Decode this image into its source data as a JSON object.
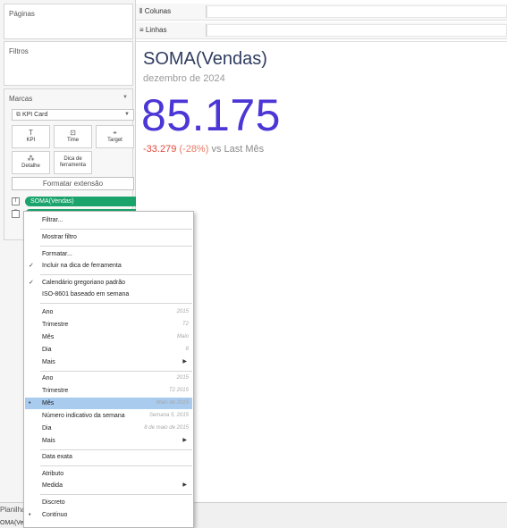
{
  "panels": {
    "pages_title": "Páginas",
    "filters_title": "Filtros",
    "marks_title": "Marcas",
    "mark_type": "KPI Card",
    "mark_buttons": [
      {
        "label": "KPI",
        "icon": "kpi-icon"
      },
      {
        "label": "Time",
        "icon": "time-icon"
      },
      {
        "label": "Target",
        "icon": "target-icon"
      },
      {
        "label": "Detalhe",
        "icon": "detail-icon"
      },
      {
        "label": "Dica de ferramenta",
        "icon": "tooltip-icon"
      }
    ],
    "format_button": "Formatar extensão",
    "pills": [
      {
        "label": "SOMA(Vendas)",
        "icon": "text-icon"
      },
      {
        "label": "",
        "icon": "chart-icon"
      }
    ]
  },
  "shelves": {
    "columns": "Colunas",
    "rows": "Linhas"
  },
  "view": {
    "title": "SOMA(Vendas)",
    "subtitle": "dezembro de 2024",
    "value": "85.175",
    "delta_value": "-33.279",
    "delta_pct": "(-28%)",
    "delta_suffix": "vs Last Mês",
    "colors": {
      "value": "#4b36d6",
      "negative": "#e0483a",
      "pill": "#1aa36b",
      "highlight": "#a8cbee"
    }
  },
  "bottom": {
    "sheet_tab": "Planilha",
    "status": "OMA(Ven"
  },
  "context_menu": {
    "items": [
      {
        "label": "Filtrar...",
        "right": "",
        "check": "",
        "submenu": false
      },
      {
        "label": "Mostrar filtro",
        "right": "",
        "check": "",
        "submenu": false
      },
      {
        "label": "Formatar...",
        "right": "",
        "check": "",
        "submenu": false
      },
      {
        "label": "Incluir na dica de ferramenta",
        "right": "",
        "check": "✓",
        "submenu": false
      },
      {
        "label": "Calendário gregoriano padrão",
        "right": "",
        "check": "✓",
        "submenu": false
      },
      {
        "label": "ISO-8601 baseado em semana",
        "right": "",
        "check": "",
        "submenu": false
      },
      {
        "label": "Ano",
        "right": "2015",
        "check": "",
        "submenu": false
      },
      {
        "label": "Trimestre",
        "right": "T2",
        "check": "",
        "submenu": false
      },
      {
        "label": "Mês",
        "right": "Maio",
        "check": "",
        "submenu": false
      },
      {
        "label": "Dia",
        "right": "8",
        "check": "",
        "submenu": false
      },
      {
        "label": "Mais",
        "right": "",
        "check": "",
        "submenu": true
      },
      {
        "label": "Ano",
        "right": "2015",
        "check": "",
        "submenu": false
      },
      {
        "label": "Trimestre",
        "right": "T2 2015",
        "check": "",
        "submenu": false
      },
      {
        "label": "Mês",
        "right": "Maio de 2015",
        "check": "•",
        "submenu": false,
        "highlighted": true
      },
      {
        "label": "Número indicativo da semana",
        "right": "Semana 5, 2015",
        "check": "",
        "submenu": false
      },
      {
        "label": "Dia",
        "right": "8 de maio de 2015",
        "check": "",
        "submenu": false
      },
      {
        "label": "Mais",
        "right": "",
        "check": "",
        "submenu": true
      },
      {
        "label": "Data exata",
        "right": "",
        "check": "",
        "submenu": false
      },
      {
        "label": "Atributo",
        "right": "",
        "check": "",
        "submenu": false
      },
      {
        "label": "Medida",
        "right": "",
        "check": "",
        "submenu": true
      },
      {
        "label": "Discreto",
        "right": "",
        "check": "",
        "submenu": false
      },
      {
        "label": "Contínuo",
        "right": "",
        "check": "•",
        "submenu": false
      }
    ]
  }
}
